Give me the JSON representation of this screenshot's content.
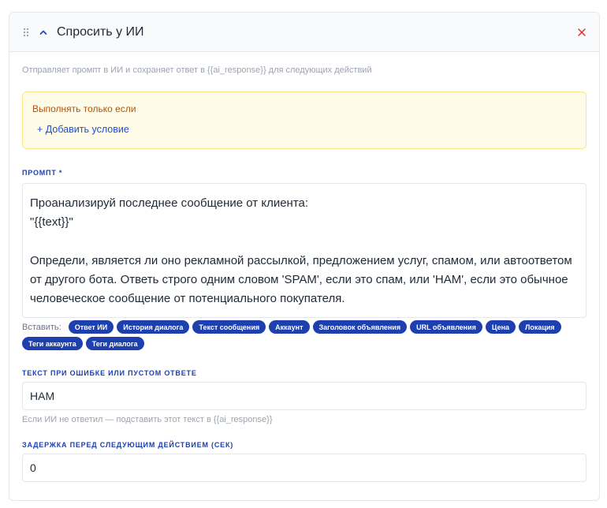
{
  "header": {
    "title": "Спросить у ИИ"
  },
  "description": "Отправляет промпт в ИИ и сохраняет ответ в {{ai_response}} для следующих действий",
  "condition": {
    "label": "Выполнять только если",
    "add_label": "+ Добавить условие"
  },
  "prompt": {
    "label": "ПРОМПТ *",
    "value": "Проанализируй последнее сообщение от клиента:\n\"{{text}}\"\n\nОпредели, является ли оно рекламной рассылкой, предложением услуг, спамом, или автоответом\nот другого бота. Ответь строго одним словом 'SPAM', если это спам, или 'HAM', если это обычное\nчеловеческое сообщение от потенциального покупателя."
  },
  "insert": {
    "label": "Вставить:",
    "chips": [
      "Ответ ИИ",
      "История диалога",
      "Текст сообщения",
      "Аккаунт",
      "Заголовок объявления",
      "URL объявления",
      "Цена",
      "Локация",
      "Теги аккаунта",
      "Теги диалога"
    ]
  },
  "fallback": {
    "label": "ТЕКСТ ПРИ ОШИБКЕ ИЛИ ПУСТОМ ОТВЕТЕ",
    "value": "HAM",
    "hint": "Если ИИ не ответил — подставить этот текст в {{ai_response}}"
  },
  "delay": {
    "label": "ЗАДЕРЖКА ПЕРЕД СЛЕДУЮЩИМ ДЕЙСТВИЕМ (СЕК)",
    "value": "0"
  },
  "colors": {
    "accent": "#1e40af",
    "close": "#dc2626",
    "condition_bg": "#fefce8",
    "condition_text": "#b45309"
  },
  "icons": [
    "drag-handle-icon",
    "chevron-up-icon",
    "close-icon"
  ]
}
